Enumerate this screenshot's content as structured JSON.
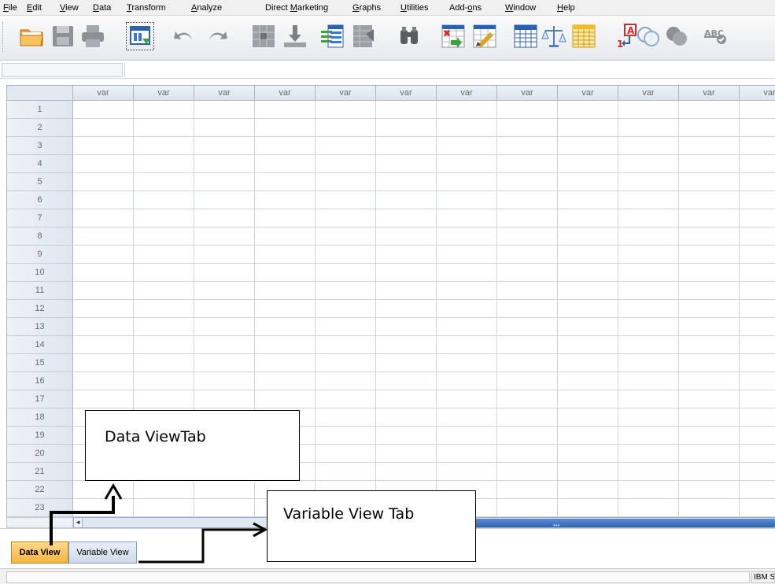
{
  "menu": [
    {
      "pre": "",
      "mn": "F",
      "post": "ile"
    },
    {
      "pre": "",
      "mn": "E",
      "post": "dit"
    },
    {
      "pre": "",
      "mn": "V",
      "post": "iew"
    },
    {
      "pre": "",
      "mn": "D",
      "post": "ata"
    },
    {
      "pre": "",
      "mn": "T",
      "post": "ransform"
    },
    {
      "pre": "",
      "mn": "A",
      "post": "nalyze"
    },
    {
      "pre": "Direct ",
      "mn": "M",
      "post": "arketing"
    },
    {
      "pre": "",
      "mn": "G",
      "post": "raphs"
    },
    {
      "pre": "",
      "mn": "U",
      "post": "tilities"
    },
    {
      "pre": "Add-",
      "mn": "o",
      "post": "ns"
    },
    {
      "pre": "",
      "mn": "W",
      "post": "indow"
    },
    {
      "pre": "",
      "mn": "H",
      "post": "elp"
    }
  ],
  "toolbar": [
    "open-folder-icon",
    "save-icon",
    "print-icon",
    "recall-dialog-icon",
    "undo-icon",
    "redo-icon",
    "goto-case-icon",
    "goto-variable-icon",
    "variables-icon",
    "run-descriptives-icon",
    "find-icon",
    "insert-cases-icon",
    "insert-variable-icon",
    "split-file-icon",
    "weight-cases-icon",
    "select-cases-icon",
    "value-labels-icon",
    "use-sets-icon",
    "show-all-variables-icon",
    "spell-check-icon"
  ],
  "grid": {
    "column_header": "var",
    "column_count": 12,
    "rows": [
      "1",
      "2",
      "3",
      "4",
      "5",
      "6",
      "7",
      "8",
      "9",
      "10",
      "11",
      "12",
      "13",
      "14",
      "15",
      "16",
      "17",
      "18",
      "19",
      "20",
      "21",
      "22",
      "23"
    ]
  },
  "scroll_left_arrow": "◄",
  "tabs": {
    "data_view": "Data View",
    "variable_view": "Variable View"
  },
  "status": {
    "text": "IBM SPSS Statistics Processor is ready"
  },
  "annotations": {
    "data_view_tab": "Data ViewTab",
    "variable_view_tab": "Variable View Tab"
  },
  "colors": {
    "active_tab": "#f4b440",
    "scroll_thumb": "#2f63ad",
    "grid_header": "#dbe4ef"
  }
}
